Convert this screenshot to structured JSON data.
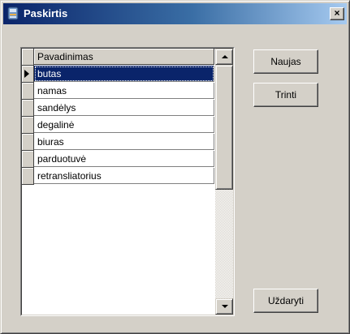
{
  "window": {
    "title": "Paskirtis",
    "close_label": "×",
    "icon": "app-icon"
  },
  "grid": {
    "column_header": "Pavadinimas",
    "selected_index": 0,
    "rows": [
      "butas",
      "namas",
      "sandėlys",
      "degalinė",
      "biuras",
      "parduotuvė",
      "retransliatorius"
    ]
  },
  "buttons": {
    "new_label": "Naujas",
    "delete_label": "Trinti",
    "close_label": "Uždaryti"
  },
  "colors": {
    "selection": "#0a246a",
    "face": "#d4d0c8",
    "title_start": "#0a246a",
    "title_end": "#a6caf0"
  }
}
